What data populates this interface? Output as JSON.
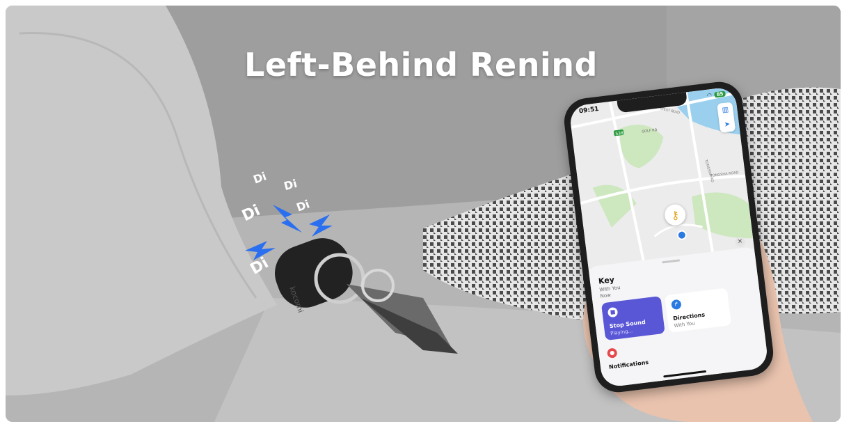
{
  "headline": "Left-Behind Renind",
  "sound_effects": [
    "Di",
    "Di",
    "Di",
    "Di",
    "Di"
  ],
  "tracker_brand": "kocomi",
  "phone": {
    "status_time": "09:51",
    "battery": "85",
    "map_labels": [
      "538",
      "WEST BLVD",
      "GOLF RD",
      "TONGSHA RD",
      "TONGSHA ROAD"
    ],
    "item_name": "Key",
    "item_status_line1": "With You",
    "item_status_line2": "Now",
    "stop_sound": {
      "label": "Stop Sound",
      "sub": "Playing..."
    },
    "directions": {
      "label": "Directions",
      "sub": "With You"
    },
    "notifications": {
      "label": "Notifications"
    }
  },
  "colors": {
    "bolt": "#2a6ff0",
    "accent": "#5a57d6",
    "map_green": "#cde7bf",
    "map_water": "#9ad0ee"
  }
}
